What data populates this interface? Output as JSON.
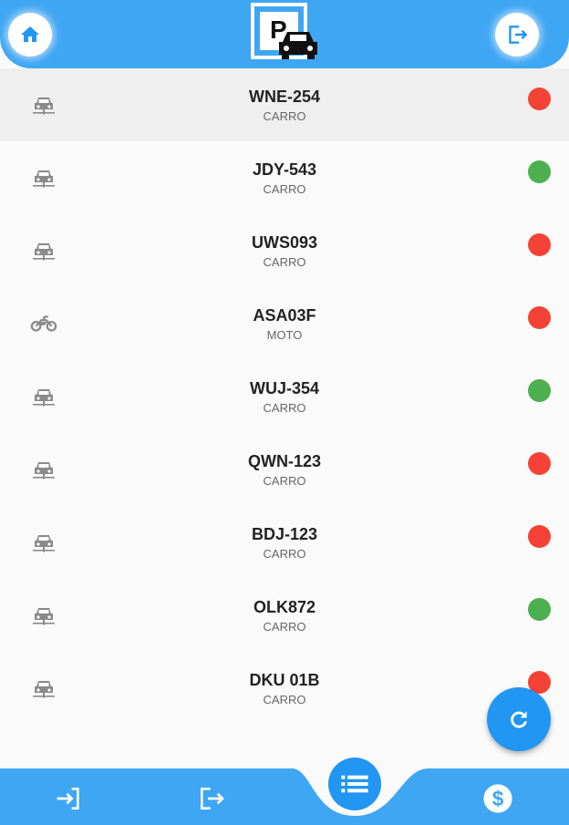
{
  "colors": {
    "primary": "#3fa6f4",
    "accent": "#2196f3",
    "status_red": "#f44336",
    "status_green": "#4caf50",
    "icon_gray": "#8a8a8a"
  },
  "header": {
    "logo_letter": "P",
    "home_icon": "home-icon",
    "logout_icon": "exit-icon"
  },
  "vehicles": [
    {
      "plate": "WNE-254",
      "type": "CARRO",
      "icon": "car-icon",
      "status": "red",
      "selected": true
    },
    {
      "plate": "JDY-543",
      "type": "CARRO",
      "icon": "car-icon",
      "status": "green"
    },
    {
      "plate": "UWS093",
      "type": "CARRO",
      "icon": "car-icon",
      "status": "red"
    },
    {
      "plate": "ASA03F",
      "type": "MOTO",
      "icon": "motorcycle-icon",
      "status": "red"
    },
    {
      "plate": "WUJ-354",
      "type": "CARRO",
      "icon": "car-icon",
      "status": "green"
    },
    {
      "plate": "QWN-123",
      "type": "CARRO",
      "icon": "car-icon",
      "status": "red"
    },
    {
      "plate": "BDJ-123",
      "type": "CARRO",
      "icon": "car-icon",
      "status": "red"
    },
    {
      "plate": "OLK872",
      "type": "CARRO",
      "icon": "car-icon",
      "status": "green"
    },
    {
      "plate": "DKU 01B",
      "type": "CARRO",
      "icon": "car-icon",
      "status": "red"
    }
  ],
  "fab": {
    "icon": "refresh-icon"
  },
  "bottom_nav": {
    "items": [
      "login-icon",
      "exit-icon",
      "list-icon",
      "dollar-icon"
    ]
  }
}
